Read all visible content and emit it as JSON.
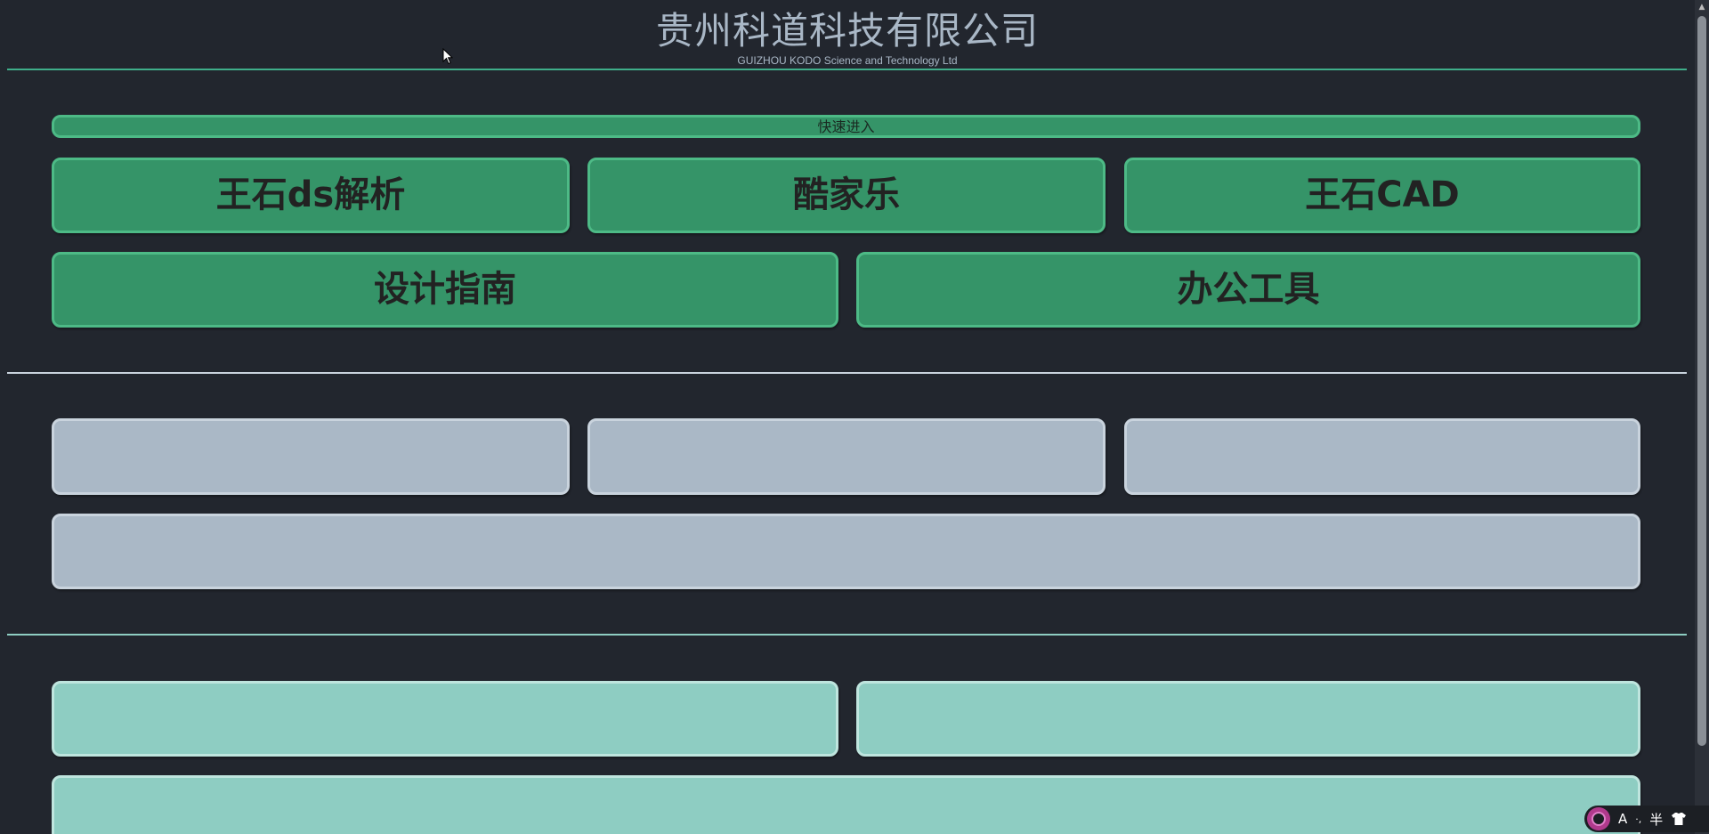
{
  "header": {
    "title": "贵州科道科技有限公司",
    "subtitle": "GUIZHOU KODO Science and Technology Ltd"
  },
  "quick_enter": {
    "label": "快速进入"
  },
  "section1": {
    "tiles": [
      {
        "label": "王石ds解析"
      },
      {
        "label": "酷家乐"
      },
      {
        "label": "王石CAD"
      },
      {
        "label": "设计指南"
      },
      {
        "label": "办公工具"
      }
    ]
  },
  "section2": {
    "tiles": [
      {
        "label": ""
      },
      {
        "label": ""
      },
      {
        "label": ""
      },
      {
        "label": ""
      }
    ]
  },
  "section3": {
    "tiles": [
      {
        "label": ""
      },
      {
        "label": ""
      },
      {
        "label": ""
      }
    ]
  },
  "ime_tray": {
    "mode_label": "A",
    "punct_label": "·,",
    "width_label": "半",
    "skin_icon": "shirt-icon",
    "logo_icon": "ime-logo-icon"
  },
  "colors": {
    "background": "#22262e",
    "divider_green": "#3fae8a",
    "divider_gray": "#c9d3dd",
    "divider_teal": "#8ecdc2",
    "quick_bar": "#359468",
    "green_tile": "#359468",
    "gray_tile": "#aab8c6",
    "teal_tile": "#8ecdc2"
  }
}
